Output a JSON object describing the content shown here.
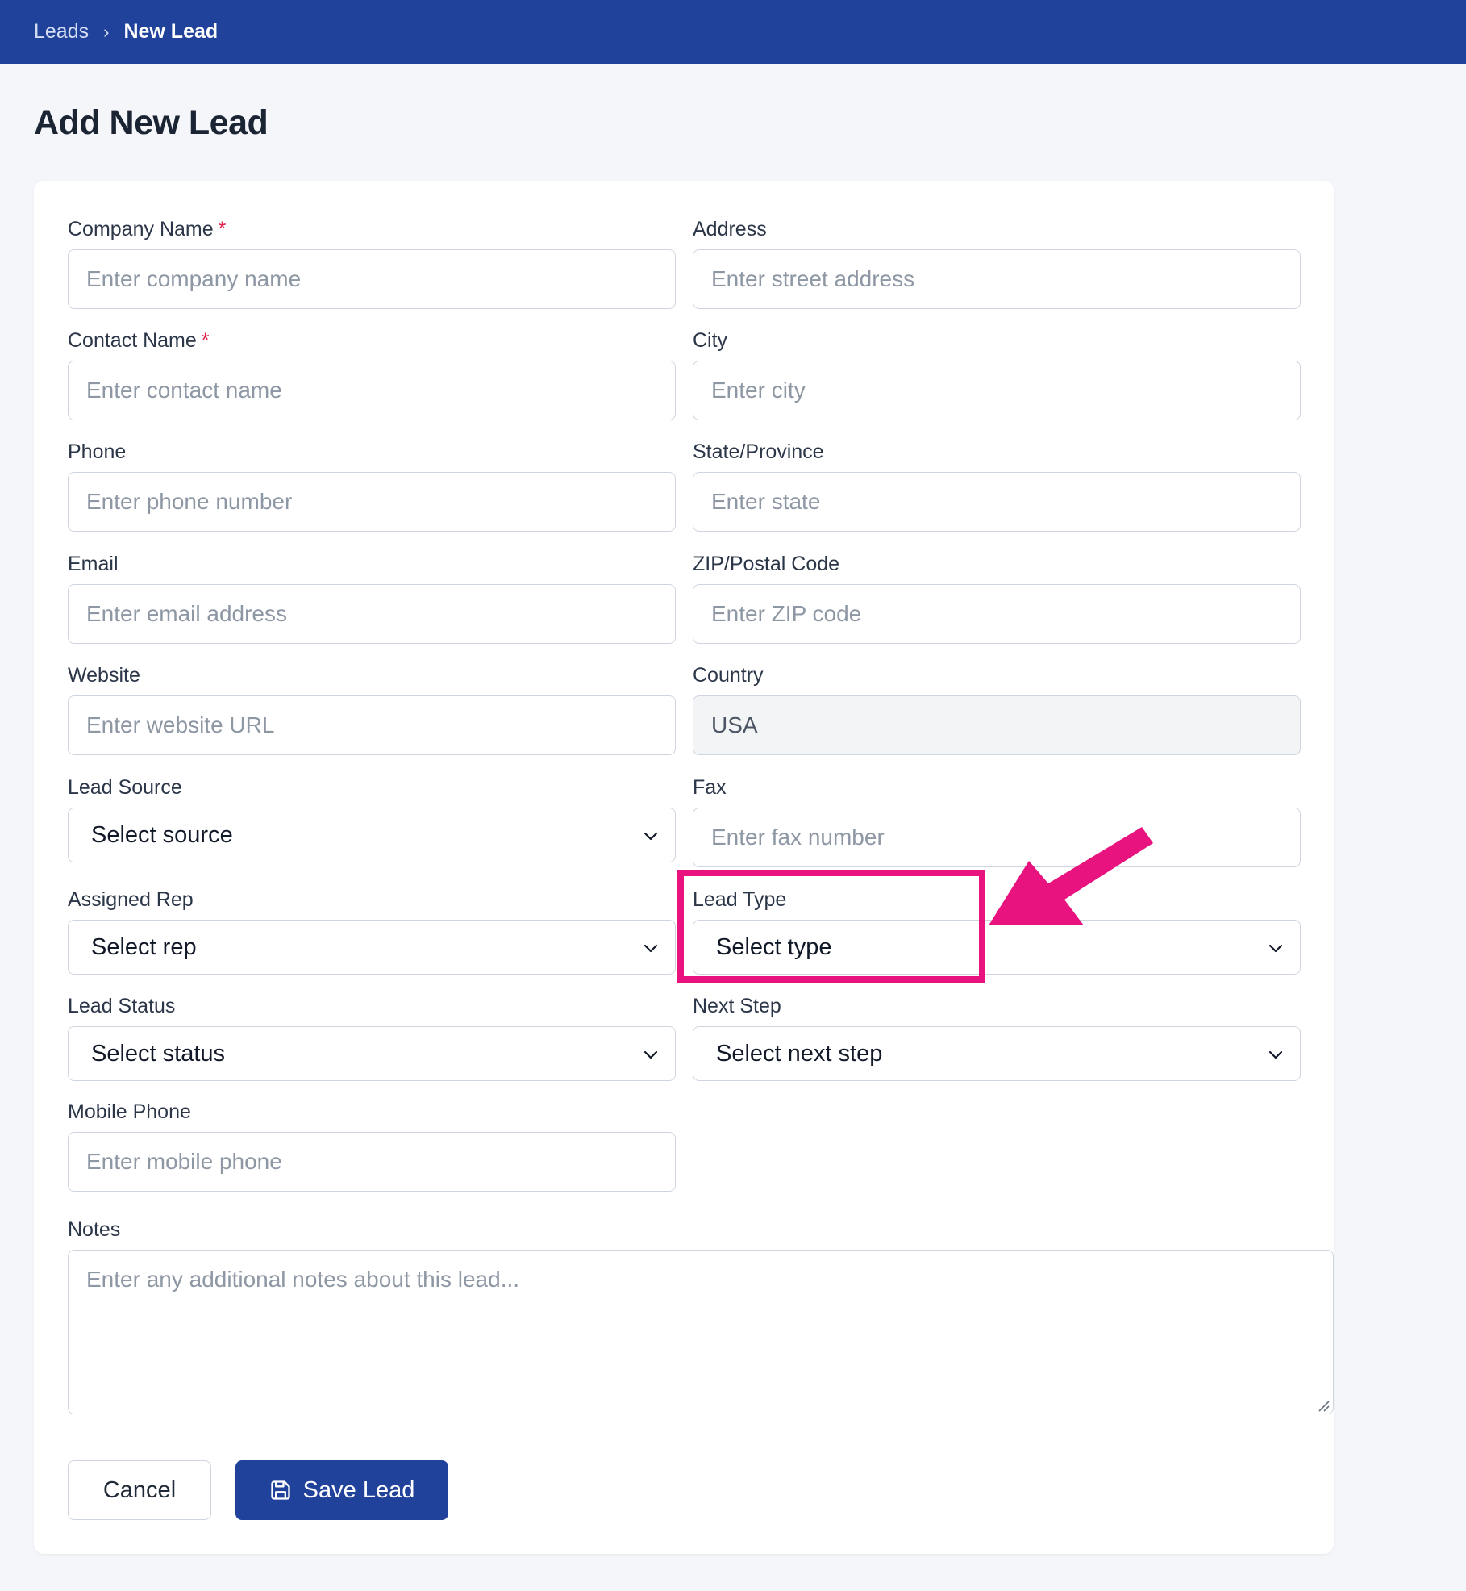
{
  "breadcrumb": {
    "parent": "Leads",
    "separator": "›",
    "current": "New Lead"
  },
  "page": {
    "title": "Add New Lead"
  },
  "form": {
    "required_marker": "*",
    "company_name": {
      "label": "Company Name",
      "placeholder": "Enter company name"
    },
    "contact_name": {
      "label": "Contact Name",
      "placeholder": "Enter contact name"
    },
    "phone": {
      "label": "Phone",
      "placeholder": "Enter phone number"
    },
    "email": {
      "label": "Email",
      "placeholder": "Enter email address"
    },
    "website": {
      "label": "Website",
      "placeholder": "Enter website URL"
    },
    "lead_source": {
      "label": "Lead Source",
      "value": "Select source"
    },
    "assigned_rep": {
      "label": "Assigned Rep",
      "value": "Select rep"
    },
    "lead_status": {
      "label": "Lead Status",
      "value": "Select status"
    },
    "mobile_phone": {
      "label": "Mobile Phone",
      "placeholder": "Enter mobile phone"
    },
    "address": {
      "label": "Address",
      "placeholder": "Enter street address"
    },
    "city": {
      "label": "City",
      "placeholder": "Enter city"
    },
    "state": {
      "label": "State/Province",
      "placeholder": "Enter state"
    },
    "zip": {
      "label": "ZIP/Postal Code",
      "placeholder": "Enter ZIP code"
    },
    "country": {
      "label": "Country",
      "value": "USA"
    },
    "fax": {
      "label": "Fax",
      "placeholder": "Enter fax number"
    },
    "lead_type": {
      "label": "Lead Type",
      "value": "Select type"
    },
    "next_step": {
      "label": "Next Step",
      "value": "Select next step"
    },
    "notes": {
      "label": "Notes",
      "placeholder": "Enter any additional notes about this lead..."
    }
  },
  "actions": {
    "cancel_label": "Cancel",
    "save_label": "Save Lead"
  },
  "icons": {
    "chevron": "chevron-down-icon",
    "save": "floppy-disk-icon",
    "annotation_arrow": "arrow-icon"
  },
  "colors": {
    "header": "#21429a",
    "primary_button": "#21429a",
    "required": "#e11d48",
    "annotation": "#e8137e"
  }
}
